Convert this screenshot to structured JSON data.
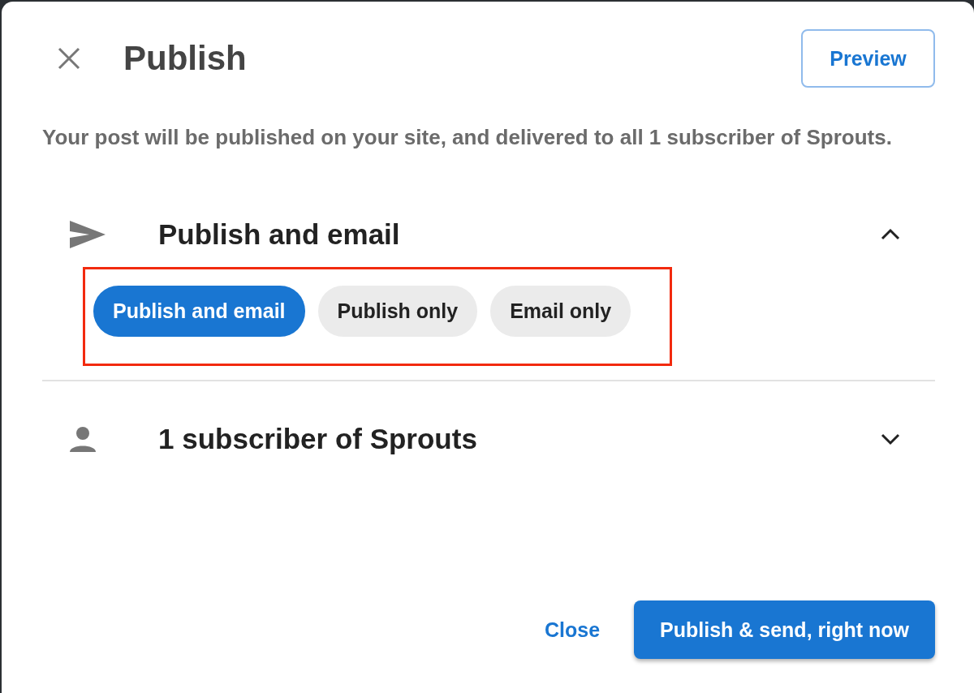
{
  "dialog": {
    "title": "Publish",
    "preview_button": "Preview",
    "description": "Your post will be published on your site, and delivered to all 1 subscriber of Sprouts."
  },
  "sections": [
    {
      "kind": "delivery",
      "title": "Publish and email",
      "expanded": true,
      "highlighted": true,
      "options": [
        {
          "label": "Publish and email",
          "selected": true
        },
        {
          "label": "Publish only",
          "selected": false
        },
        {
          "label": "Email only",
          "selected": false
        }
      ]
    },
    {
      "kind": "recipients",
      "title": "1 subscriber of Sprouts",
      "expanded": false
    }
  ],
  "footer": {
    "secondary": "Close",
    "primary": "Publish & send, right now"
  }
}
